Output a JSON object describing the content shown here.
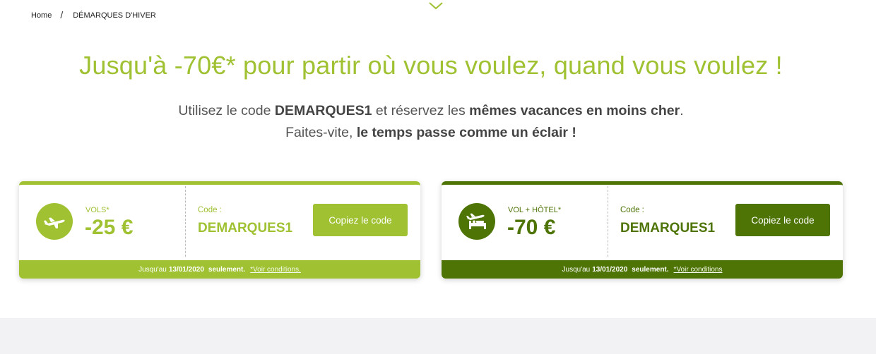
{
  "breadcrumb": {
    "home": "Home",
    "separator": "/",
    "current": "DÉMARQUES D'HIVER"
  },
  "headline": "Jusqu'à -70€* pour partir où vous voulez, quand vous voulez !",
  "subtitle": {
    "line1_part1": "Utilisez le code ",
    "line1_code": "DEMARQUES1",
    "line1_part2": " et réservez les ",
    "line1_bold": "mêmes vacances en moins cher",
    "line1_end": ".",
    "line2_part1": "Faites-vite, ",
    "line2_bold": "le temps passe comme un éclair !"
  },
  "cards": [
    {
      "type_label": "VOLS*",
      "amount": "-25 €",
      "code_label": "Code :",
      "code_value": "DEMARQUES1",
      "button_label": "Copiez le code",
      "footer_prefix": "Jusqu'au",
      "footer_date": "13/01/2020",
      "footer_suffix": "seulement.",
      "footer_link": "*Voir conditions.",
      "icon": "plane-icon",
      "color": "#9fc132"
    },
    {
      "type_label": "VOL + HÔTEL*",
      "amount": "-70 €",
      "code_label": "Code :",
      "code_value": "DEMARQUES1",
      "button_label": "Copiez le code",
      "footer_prefix": "Jusqu'au",
      "footer_date": "13/01/2020",
      "footer_suffix": "seulement.",
      "footer_link": "*Voir conditions",
      "icon": "plane-bed-icon",
      "color": "#4e7406"
    }
  ],
  "colors": {
    "light_green": "#9fc132",
    "dark_green": "#4e7406",
    "text_grey": "#555555",
    "band": "#f2f1f4"
  }
}
